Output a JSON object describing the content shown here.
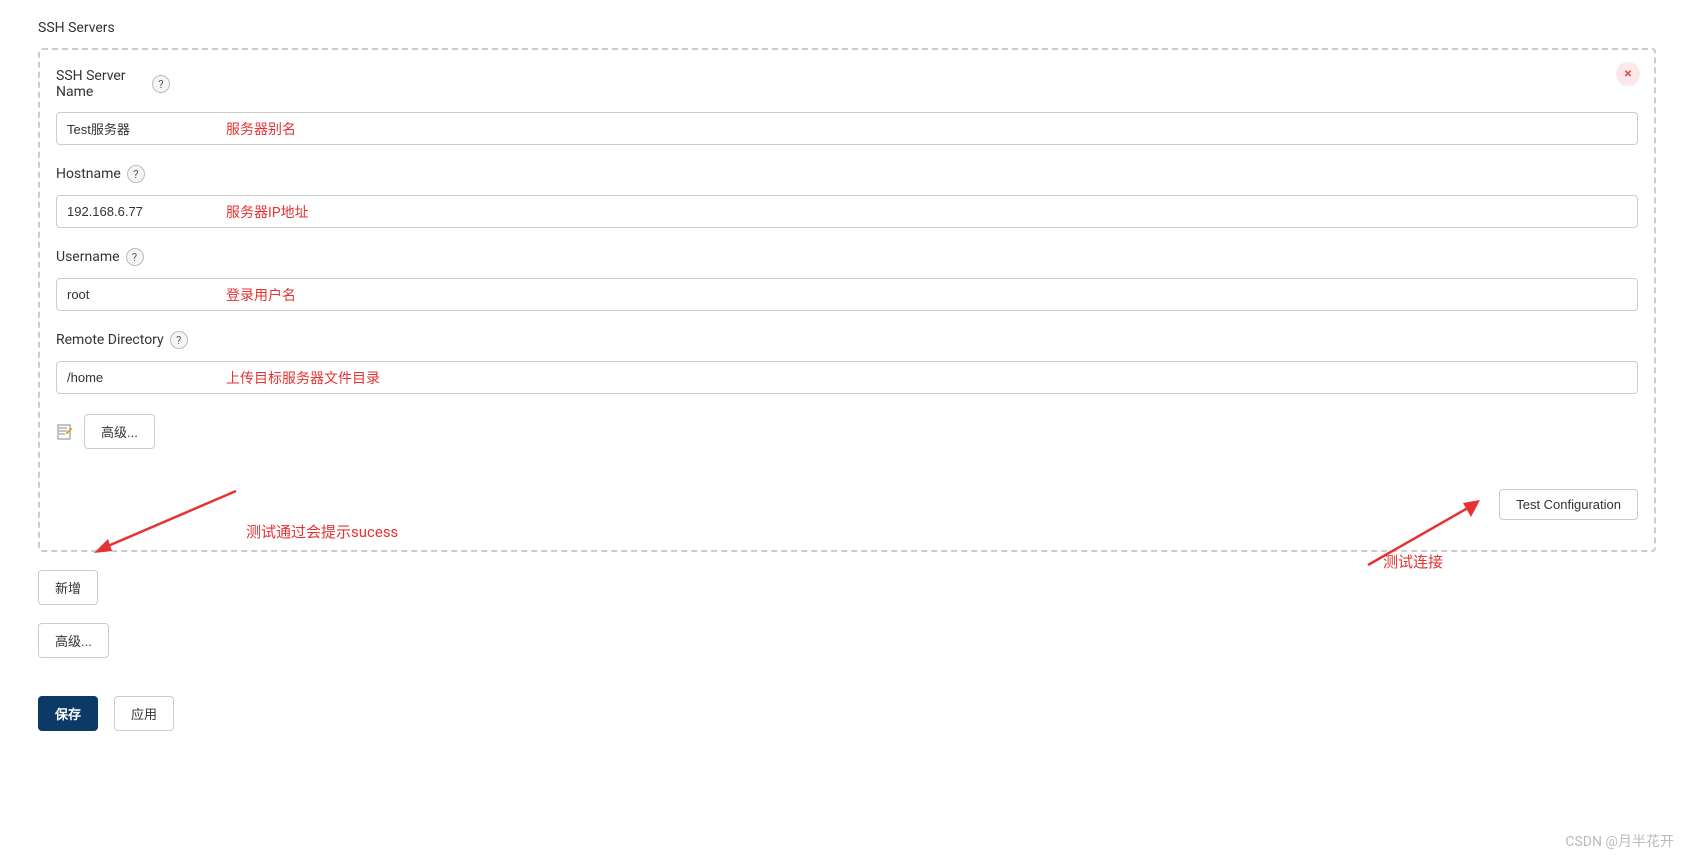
{
  "section": {
    "title": "SSH Servers"
  },
  "form": {
    "server_name": {
      "label": "SSH Server Name",
      "value": "Test服务器",
      "annotation": "服务器别名"
    },
    "hostname": {
      "label": "Hostname",
      "value": "192.168.6.77",
      "annotation": "服务器IP地址"
    },
    "username": {
      "label": "Username",
      "value": "root",
      "annotation": "登录用户名"
    },
    "remote_directory": {
      "label": "Remote Directory",
      "value": "/home",
      "annotation": "上传目标服务器文件目录"
    },
    "advanced_button": "高级...",
    "test_config_button": "Test Configuration",
    "test_success_annotation": "测试通过会提示sucess",
    "test_connect_annotation": "测试连接"
  },
  "buttons": {
    "add": "新增",
    "advanced": "高级...",
    "save": "保存",
    "apply": "应用"
  },
  "help_icon": "?",
  "close_icon": "×",
  "watermark": "CSDN @月半花开"
}
